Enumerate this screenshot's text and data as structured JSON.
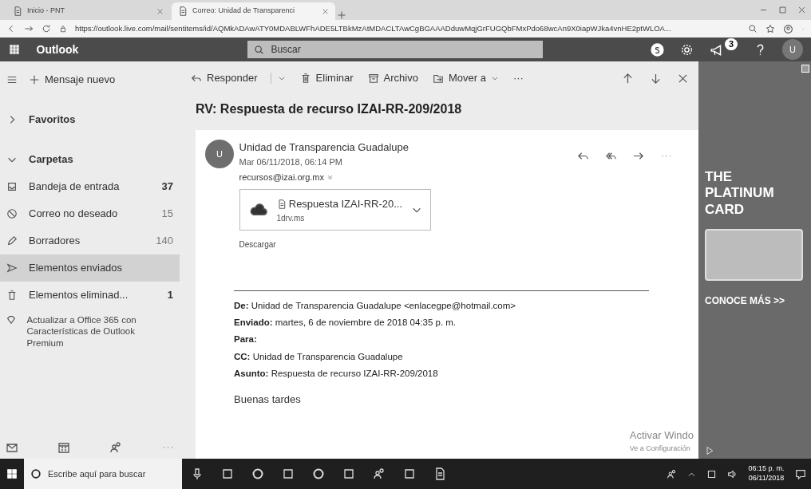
{
  "browser": {
    "tabs": [
      {
        "title": "Inicio - PNT",
        "selected": false
      },
      {
        "title": "Correo: Unidad de Transparenci",
        "selected": true
      }
    ],
    "url": "https://outlook.live.com/mail/sentitems/id/AQMkADAwATY0MDABLWFhADE5LTBkMzAtMDACLTAwCgBGAAADduwMqjGrFUGQbFMxPdo68wcAn9X0iapWJka4vnHE2ptWLOA..."
  },
  "app": {
    "name": "Outlook",
    "search_placeholder": "Buscar",
    "notification_count": "3",
    "avatar_initial": "U"
  },
  "sidebar": {
    "new_message": "Mensaje nuevo",
    "sections": [
      {
        "label": "Favoritos",
        "expanded": false
      },
      {
        "label": "Carpetas",
        "expanded": true
      }
    ],
    "folders": [
      {
        "kind": "inbox",
        "label": "Bandeja de entrada",
        "count": "37",
        "unread": true,
        "selected": false
      },
      {
        "kind": "junk",
        "label": "Correo no deseado",
        "count": "15",
        "unread": false,
        "selected": false
      },
      {
        "kind": "drafts",
        "label": "Borradores",
        "count": "140",
        "unread": false,
        "selected": false
      },
      {
        "kind": "sent",
        "label": "Elementos enviados",
        "selected": true
      },
      {
        "kind": "deleted",
        "label": "Elementos eliminad...",
        "count": "1",
        "unread": true,
        "selected": false
      }
    ],
    "upgrade": "Actualizar a Office 365 con Características de Outlook Premium"
  },
  "toolbar": {
    "actions": [
      {
        "kind": "reply",
        "label": "Responder"
      },
      {
        "kind": "delete",
        "label": "Eliminar"
      },
      {
        "kind": "archive",
        "label": "Archivo"
      },
      {
        "kind": "move",
        "label": "Mover a"
      },
      {
        "kind": "more",
        "label": "···"
      }
    ]
  },
  "message": {
    "subject": "RV: Respuesta de recurso IZAI-RR-209/2018",
    "avatar_initial": "U",
    "sender": "Unidad de Transparencia Guadalupe",
    "date": "Mar 06/11/2018, 06:14 PM",
    "to": "recursos@izai.org.mx",
    "attachment": {
      "name": "Respuesta IZAI-RR-20...",
      "source": "1drv.ms"
    },
    "download": "Descargar",
    "header_lines": [
      "**De:** Unidad de Transparencia Guadalupe <enlacegpe@hotmail.com>",
      "**Enviado:** martes, 6 de noviembre de 2018 04:35 p. m.",
      "**Para:**",
      "**CC:** Unidad de Transparencia Guadalupe",
      "**Asunto:** Respuesta de recurso IZAI-RR-209/2018"
    ],
    "greeting": "Buenas tardes"
  },
  "ad": {
    "title": "THE PLATINUM CARD",
    "cta": "CONOCE MÁS >>"
  },
  "activation": {
    "title": "Activar Windo",
    "subtitle": "Ve a Configuración"
  },
  "taskbar": {
    "search_placeholder": "Escribe aquí para buscar",
    "time": "06:15 p. m.",
    "date": "06/11/2018"
  }
}
